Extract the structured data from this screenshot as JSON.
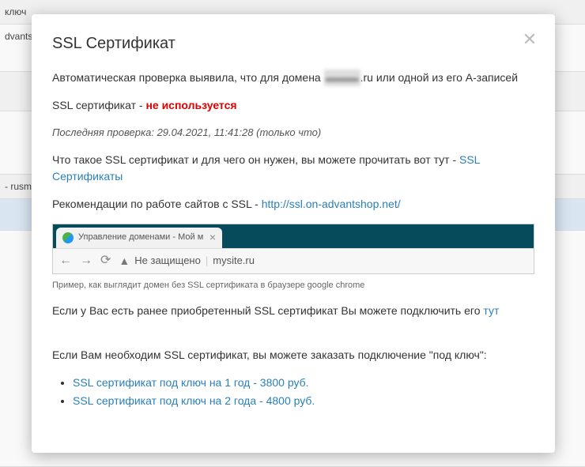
{
  "background": {
    "rows": [
      "ключ",
      "dvants",
      "",
      "",
      "- rusm",
      ""
    ]
  },
  "modal": {
    "title": "SSL Сертификат",
    "p1_before": "Автоматическая проверка выявила, что для домена ",
    "p1_domain_blurred": "▬▬▬",
    "p1_domain_suffix": ".ru",
    "p1_after": " или одной из его A-записей",
    "p2_before": "SSL сертификат - ",
    "p2_status": "не используется",
    "check_time": "Последняя проверка: 29.04.2021, 11:41:28 (только что)",
    "p3_before": "Что такое SSL сертификат и для чего он нужен, вы можете прочитать вот тут - ",
    "p3_link": "SSL Сертификаты",
    "p4_before": "Рекомендации по работе сайтов с SSL - ",
    "p4_link": "http://ssl.on-advantshop.net/",
    "browser": {
      "tab_title": "Управление доменами - Мой м",
      "not_secure_label": "Не защищено",
      "address": "mysite.ru"
    },
    "caption": "Пример, как выглядит домен без SSL сертификата в браузере google chrome",
    "p5_before": "Если у Вас есть ранее приобретенный SSL сертификат Вы можете подключить его ",
    "p5_link": "тут",
    "p6": "Если Вам необходим SSL сертификат, вы можете заказать подключение \"под ключ\":",
    "offers": [
      "SSL сертификат под ключ на 1 год - 3800 руб.",
      "SSL сертификат под ключ на 2 года - 4800 руб."
    ]
  }
}
